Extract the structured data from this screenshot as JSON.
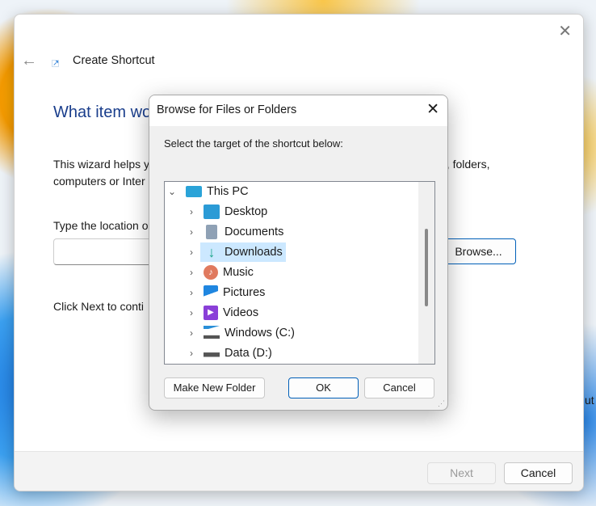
{
  "background_text": "ut",
  "wizard": {
    "title": "Create Shortcut",
    "heading": "What item wo",
    "description_line1": "This wizard helps y",
    "description_line1_tail": "es, folders,",
    "description_line2": "computers or Inter",
    "location_label": "Type the location o",
    "location_value": "",
    "browse_label": "Browse...",
    "continue_text": "Click Next to conti",
    "next_label": "Next",
    "cancel_label": "Cancel"
  },
  "dialog": {
    "title": "Browse for Files or Folders",
    "instruction": "Select the target of the shortcut below:",
    "tree": [
      {
        "label": "This PC",
        "icon": "monitor-icon",
        "expanded": true,
        "level": 0
      },
      {
        "label": "Desktop",
        "icon": "desktop-icon",
        "level": 1
      },
      {
        "label": "Documents",
        "icon": "documents-icon",
        "level": 1
      },
      {
        "label": "Downloads",
        "icon": "download-icon",
        "level": 1,
        "selected": true
      },
      {
        "label": "Music",
        "icon": "music-icon",
        "level": 1
      },
      {
        "label": "Pictures",
        "icon": "pictures-icon",
        "level": 1
      },
      {
        "label": "Videos",
        "icon": "videos-icon",
        "level": 1
      },
      {
        "label": "Windows (C:)",
        "icon": "drive-c-icon",
        "level": 1
      },
      {
        "label": "Data (D:)",
        "icon": "drive-d-icon",
        "level": 1
      }
    ],
    "new_folder_label": "Make New Folder",
    "ok_label": "OK",
    "cancel_label": "Cancel"
  },
  "colors": {
    "heading": "#1a3e8c",
    "selection": "#cce8ff",
    "accent": "#005fb8"
  }
}
